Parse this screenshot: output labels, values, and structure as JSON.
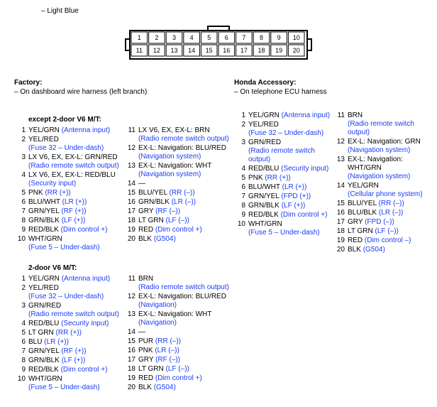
{
  "top_note": "– Light Blue",
  "connector_pins": [
    "1",
    "2",
    "3",
    "4",
    "5",
    "6",
    "7",
    "8",
    "9",
    "10",
    "11",
    "12",
    "13",
    "14",
    "15",
    "16",
    "17",
    "18",
    "19",
    "20"
  ],
  "factory": {
    "title": "Factory:",
    "sub": "– On dashboard wire harness (left branch)"
  },
  "accessory": {
    "title": "Honda Accessory:",
    "sub": "– On telephone ECU harness"
  },
  "except_title": "except 2-door V6 M/T:",
  "except_col1": [
    {
      "n": "1",
      "wire": "YEL/GRN ",
      "link": "(Antenna input)"
    },
    {
      "n": "2",
      "wire": "YEL/RED",
      "link": "",
      "sub": "(Fuse 32 – Under-dash)"
    },
    {
      "n": "3",
      "wire": "LX V6, EX, EX-L: GRN/RED",
      "link": "",
      "sub": "(Radio remote switch output)"
    },
    {
      "n": "4",
      "wire": "LX V6, EX, EX-L: RED/BLU",
      "link": "",
      "sub": "(Security input)"
    },
    {
      "n": "5",
      "wire": "PNK ",
      "link": "(RR (+))"
    },
    {
      "n": "6",
      "wire": "BLU/WHT ",
      "link": "(LR (+))"
    },
    {
      "n": "7",
      "wire": "GRN/YEL ",
      "link": "(RF (+))"
    },
    {
      "n": "8",
      "wire": "GRN/BLK ",
      "link": "(LF (+))"
    },
    {
      "n": "9",
      "wire": "RED/BLK ",
      "link": "(Dim control +)"
    },
    {
      "n": "10",
      "wire": "WHT/GRN",
      "link": "",
      "sub": "(Fuse 5 – Under-dash)"
    }
  ],
  "except_col2": [
    {
      "n": "11",
      "wire": "LX V6, EX, EX-L: BRN",
      "link": "",
      "sub": "(Radio remote switch output)"
    },
    {
      "n": "12",
      "wire": "EX-L: Navigation: BLU/RED",
      "link": "",
      "sub": "(Navigation system)"
    },
    {
      "n": "13",
      "wire": "EX-L: Navigation: WHT",
      "link": "",
      "sub": "(Navigation system)"
    },
    {
      "n": "14",
      "wire": "—",
      "link": ""
    },
    {
      "n": "15",
      "wire": "BLU/YEL ",
      "link": "(RR (–))"
    },
    {
      "n": "16",
      "wire": "GRN/BLK ",
      "link": "(LR (–))"
    },
    {
      "n": "17",
      "wire": "GRY ",
      "link": "(RF (–))"
    },
    {
      "n": "18",
      "wire": "LT GRN ",
      "link": "(LF (–))"
    },
    {
      "n": "19",
      "wire": "RED ",
      "link": "(Dim control +)"
    },
    {
      "n": "20",
      "wire": "BLK ",
      "link": "(G504)"
    }
  ],
  "two_door_title": "2-door V6 M/T:",
  "two_door_col1": [
    {
      "n": "1",
      "wire": "YEL/GRN ",
      "link": "(Antenna input)"
    },
    {
      "n": "2",
      "wire": "YEL/RED",
      "link": "",
      "sub": "(Fuse 32 – Under-dash)"
    },
    {
      "n": "3",
      "wire": "GRN/RED",
      "link": "",
      "sub": "(Radio remote switch output)"
    },
    {
      "n": "4",
      "wire": "RED/BLU ",
      "link": "(Security input)"
    },
    {
      "n": "5",
      "wire": "LT GRN ",
      "link": "(RR (+))"
    },
    {
      "n": "6",
      "wire": "BLU ",
      "link": "(LR (+))"
    },
    {
      "n": "7",
      "wire": "GRN/YEL ",
      "link": "(RF (+))"
    },
    {
      "n": "8",
      "wire": "GRN/BLK ",
      "link": "(LF (+))"
    },
    {
      "n": "9",
      "wire": "RED/BLK ",
      "link": "(Dim control +)"
    },
    {
      "n": "10",
      "wire": "WHT/GRN",
      "link": "",
      "sub": "(Fuse 5 – Under-dash)"
    }
  ],
  "two_door_col2": [
    {
      "n": "11",
      "wire": "BRN",
      "link": "",
      "sub": "(Radio remote switch output)"
    },
    {
      "n": "12",
      "wire": "EX-L: Navigation: BLU/RED",
      "link": "",
      "sub": "(Navigation)"
    },
    {
      "n": "13",
      "wire": "EX-L: Navigation: WHT",
      "link": "",
      "sub": "(Navigation)"
    },
    {
      "n": "14",
      "wire": "—",
      "link": ""
    },
    {
      "n": "15",
      "wire": "PUR ",
      "link": "(RR (–))"
    },
    {
      "n": "16",
      "wire": "PNK ",
      "link": "(LR (–))"
    },
    {
      "n": "17",
      "wire": "GRY ",
      "link": "(RF (–))"
    },
    {
      "n": "18",
      "wire": "LT GRN ",
      "link": "(LF (–))"
    },
    {
      "n": "19",
      "wire": "RED ",
      "link": "(Dim control +)"
    },
    {
      "n": "20",
      "wire": "BLK ",
      "link": "(G504)"
    }
  ],
  "acc_col1": [
    {
      "n": "1",
      "wire": "YEL/GRN ",
      "link": "(Antenna input)"
    },
    {
      "n": "2",
      "wire": "YEL/RED",
      "link": "",
      "sub": "(Fuse 32 – Under-dash)"
    },
    {
      "n": "3",
      "wire": "GRN/RED",
      "link": "",
      "sub": "(Radio remote switch output)"
    },
    {
      "n": "4",
      "wire": "RED/BLU ",
      "link": "(Security input)"
    },
    {
      "n": "5",
      "wire": "PNK ",
      "link": "(RR (+))"
    },
    {
      "n": "6",
      "wire": "BLU/WHT ",
      "link": "(LR (+))"
    },
    {
      "n": "7",
      "wire": "GRN/YEL ",
      "link": "(FPD (+))"
    },
    {
      "n": "8",
      "wire": "GRN/BLK ",
      "link": "(LF (+))"
    },
    {
      "n": "9",
      "wire": "RED/BLK ",
      "link": "(Dim control +)"
    },
    {
      "n": "10",
      "wire": "WHT/GRN",
      "link": "",
      "sub": "(Fuse 5 – Under-dash)"
    }
  ],
  "acc_col2": [
    {
      "n": "11",
      "wire": "BRN",
      "link": "",
      "sub": "(Radio remote switch output)"
    },
    {
      "n": "12",
      "wire": "EX-L: Navigation: GRN",
      "link": "",
      "sub": "(Navigation system)"
    },
    {
      "n": "13",
      "wire": "EX-L: Navigation: WHT/GRN",
      "link": "",
      "sub": "(Navigation system)"
    },
    {
      "n": "14",
      "wire": "YEL/GRN",
      "link": "",
      "sub": "(Cellular phone system)"
    },
    {
      "n": "15",
      "wire": "BLU/YEL ",
      "link": "(RR (–))"
    },
    {
      "n": "16",
      "wire": "BLU/BLK ",
      "link": "(LR (–))"
    },
    {
      "n": "17",
      "wire": "GRY ",
      "link": "(FPD (–))"
    },
    {
      "n": "18",
      "wire": "LT GRN ",
      "link": "(LF (–))"
    },
    {
      "n": "19",
      "wire": "RED ",
      "link": "(Dim control –)"
    },
    {
      "n": "20",
      "wire": "BLK ",
      "link": "(G504)"
    }
  ]
}
